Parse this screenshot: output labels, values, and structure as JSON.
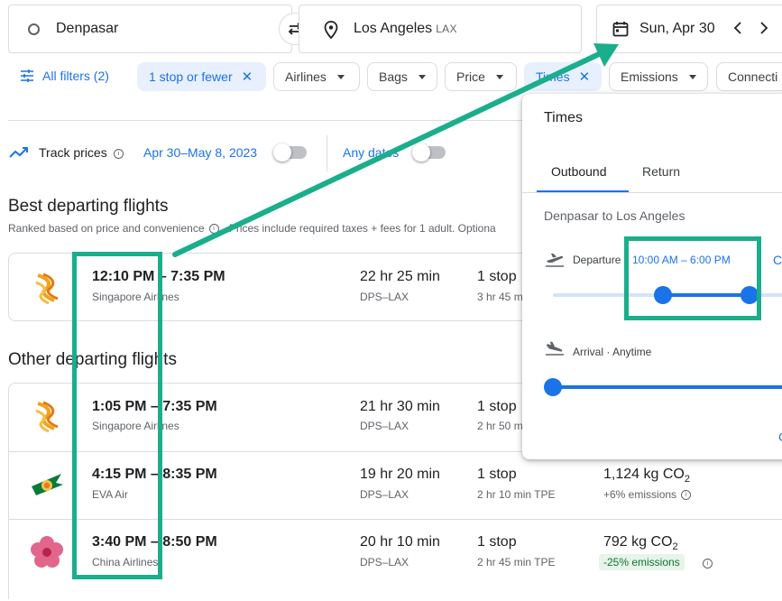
{
  "search": {
    "origin": "Denpasar",
    "destination": "Los Angeles",
    "destination_code": "LAX",
    "date": "Sun, Apr 30"
  },
  "filters": {
    "all_filters": "All filters (2)",
    "stops": "1 stop or fewer",
    "airlines": "Airlines",
    "bags": "Bags",
    "price": "Price",
    "times": "Times",
    "emissions": "Emissions",
    "connecting": "Connecti"
  },
  "track": {
    "label": "Track prices",
    "dates": "Apr 30–May 8, 2023",
    "any_dates": "Any dates"
  },
  "best": {
    "heading": "Best departing flights",
    "subtitle": "Ranked based on price and convenience",
    "note": "Prices include required taxes + fees for 1 adult. Optiona",
    "flights": [
      {
        "times": "12:10 PM – 7:35 PM",
        "airline": "Singapore Airlines",
        "duration": "22 hr 25 min",
        "route": "DPS–LAX",
        "stops": "1 stop",
        "layover": "3 hr 45 m"
      }
    ]
  },
  "other": {
    "heading": "Other departing flights",
    "flights": [
      {
        "times": "1:05 PM – 7:35 PM",
        "airline": "Singapore Airlines",
        "duration": "21 hr 30 min",
        "route": "DPS–LAX",
        "stops": "1 stop",
        "layover": "2 hr 50 m",
        "co2": "",
        "co2_unit": "",
        "emissions": ""
      },
      {
        "times": "4:15 PM – 8:35 PM",
        "airline": "EVA Air",
        "duration": "19 hr 20 min",
        "route": "DPS–LAX",
        "stops": "1 stop",
        "layover": "2 hr 10 min TPE",
        "co2": "1,124 kg CO",
        "co2_unit": "2",
        "emissions": "+6% emissions"
      },
      {
        "times": "3:40 PM – 8:50 PM",
        "airline": "China Airlines",
        "duration": "20 hr 10 min",
        "route": "DPS–LAX",
        "stops": "1 stop",
        "layover": "2 hr 45 min TPE",
        "co2": "792 kg CO",
        "co2_unit": "2",
        "emissions": "-25% emissions"
      }
    ]
  },
  "times_panel": {
    "title": "Times",
    "tab_outbound": "Outbound",
    "tab_return": "Return",
    "route": "Denpasar to Los Angeles",
    "departure_label": "Departure",
    "departure_value": "10:00 AM – 6:00 PM",
    "departure_extra": "C",
    "arrival_label": "Arrival · Anytime",
    "footer_char": "C"
  },
  "colors": {
    "accent": "#1a73e8",
    "annotation": "#1aae8c",
    "emissions_low_bg": "#e6f4ea"
  }
}
